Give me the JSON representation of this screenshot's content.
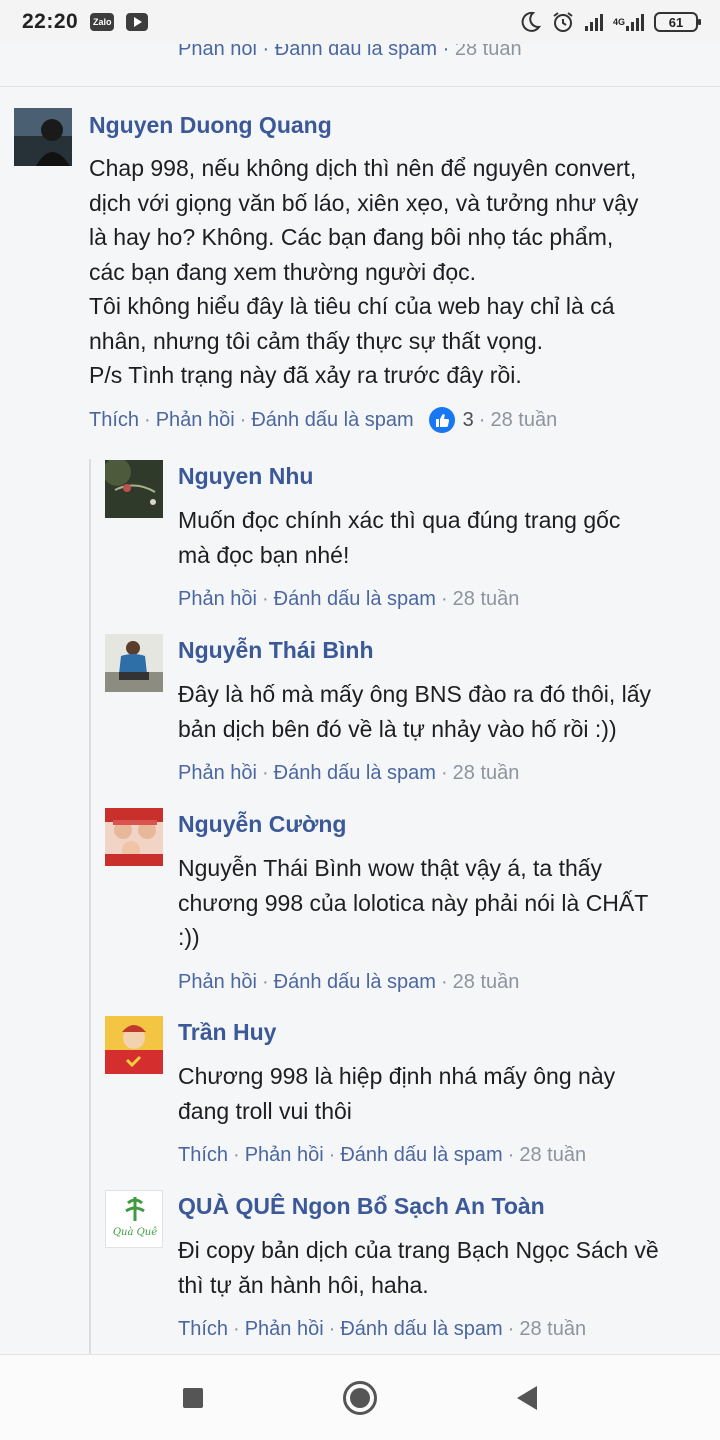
{
  "status_bar": {
    "time": "22:20",
    "apps": [
      "Zalo",
      "YouTube"
    ],
    "network_label": "4G",
    "battery": "61"
  },
  "top_actions": {
    "reply": "Phản hồi",
    "spam": "Đánh dấu là spam",
    "time": "28 tuần"
  },
  "comments": [
    {
      "name": "Nguyen Duong Quang",
      "lines": [
        "Chap 998, nếu không dịch thì nên để nguyên convert,",
        "dịch với giọng văn bố láo, xiên xẹo, và tưởng như vậy",
        "là hay ho? Không. Các bạn đang bôi nhọ tác phẩm,",
        "các bạn đang xem thường người đọc.",
        "Tôi không hiểu đây là tiêu chí của web hay chỉ là cá",
        "nhân, nhưng tôi cảm thấy thực sự thất vọng.",
        "P/s Tình trạng này đã xảy ra trước đây rồi."
      ],
      "like": "Thích",
      "reply": "Phản hồi",
      "spam": "Đánh dấu là spam",
      "like_count": "3",
      "time": "28 tuần"
    }
  ],
  "replies": [
    {
      "name": "Nguyen Nhu",
      "lines": [
        "Muốn đọc chính xác thì qua đúng trang gốc",
        "mà đọc bạn nhé!"
      ],
      "reply": "Phản hồi",
      "spam": "Đánh dấu là spam",
      "time": "28 tuần"
    },
    {
      "name": "Nguyễn Thái Bình",
      "lines": [
        "Đây là hố mà mấy ông BNS đào ra đó thôi, lấy",
        "bản dịch bên đó về là tự nhảy vào hố rồi :))"
      ],
      "reply": "Phản hồi",
      "spam": "Đánh dấu là spam",
      "time": "28 tuần"
    },
    {
      "name": "Nguyễn Cường",
      "lines": [
        "Nguyễn Thái Bình wow thật vậy á, ta thấy",
        "chương 998 của lolotica này phải nói là CHẤT",
        ":))"
      ],
      "reply": "Phản hồi",
      "spam": "Đánh dấu là spam",
      "time": "28 tuần"
    },
    {
      "name": "Trần Huy",
      "lines": [
        "Chương 998 là hiệp định nhá mấy ông này",
        "đang troll vui thôi"
      ],
      "like": "Thích",
      "reply": "Phản hồi",
      "spam": "Đánh dấu là spam",
      "time": "28 tuần"
    },
    {
      "name": "QUÀ QUÊ Ngon Bổ Sạch An Toàn",
      "avatar_logo": "Quà Quê",
      "lines": [
        "Đi copy bản dịch của trang Bạch Ngọc Sách về",
        "thì tự ăn hành hôi, haha."
      ],
      "like": "Thích",
      "reply": "Phản hồi",
      "spam": "Đánh dấu là spam",
      "time": "28 tuần"
    }
  ],
  "icons": {
    "status": [
      "moon-icon",
      "alarm-icon",
      "signal-icon",
      "battery-icon"
    ],
    "nav": [
      "recent-apps-icon",
      "home-icon",
      "back-icon"
    ],
    "reaction": "like-thumb-icon"
  },
  "colors": {
    "name": "#3b5998",
    "link": "#4b67a1",
    "muted": "#8d949e",
    "text": "#1c1e21",
    "like_badge": "#1877f2"
  }
}
